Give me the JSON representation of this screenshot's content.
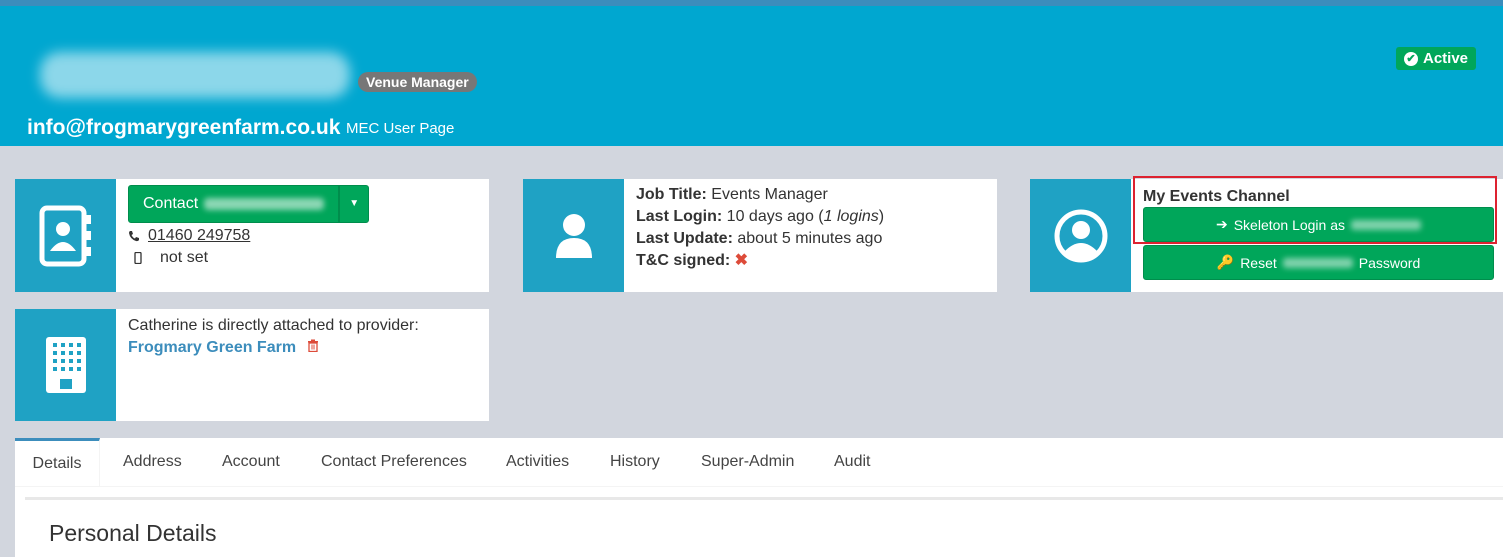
{
  "header": {
    "role_badge": "Venue Manager",
    "email": "info@frogmarygreenfarm.co.uk",
    "user_page_label": "MEC User Page",
    "status_label": "Active"
  },
  "contact": {
    "button_label": "Contact",
    "phone": "01460 249758",
    "mobile": "not set"
  },
  "profile": {
    "job_title_label": "Job Title:",
    "job_title": "Events Manager",
    "last_login_label": "Last Login:",
    "last_login": "10 days ago (",
    "logins": "1 logins",
    "last_login_close": ")",
    "last_update_label": "Last Update:",
    "last_update": "about 5 minutes ago",
    "tc_label": "T&C signed:"
  },
  "channel": {
    "title": "My Events Channel",
    "skeleton_login": "Skeleton Login as",
    "reset_prefix": "Reset",
    "reset_suffix": "Password"
  },
  "provider": {
    "text": "Catherine is directly attached to provider:",
    "name": "Frogmary Green Farm"
  },
  "tabs": [
    {
      "label": "Details"
    },
    {
      "label": "Address"
    },
    {
      "label": "Account"
    },
    {
      "label": "Contact Preferences"
    },
    {
      "label": "Activities"
    },
    {
      "label": "History"
    },
    {
      "label": "Super-Admin"
    },
    {
      "label": "Audit"
    }
  ],
  "panel": {
    "title": "Personal Details"
  },
  "colors": {
    "header": "#00a7d0",
    "success": "#00a65a",
    "icon_cell": "#1fa2c4",
    "danger": "#dd4b39"
  },
  "icons": [
    "contact-book-icon",
    "user-icon",
    "user-circle-icon",
    "building-icon",
    "phone-icon",
    "mobile-icon",
    "sign-in-icon",
    "key-icon",
    "trash-icon",
    "check-circle-icon",
    "caret-down-icon",
    "x-icon"
  ]
}
